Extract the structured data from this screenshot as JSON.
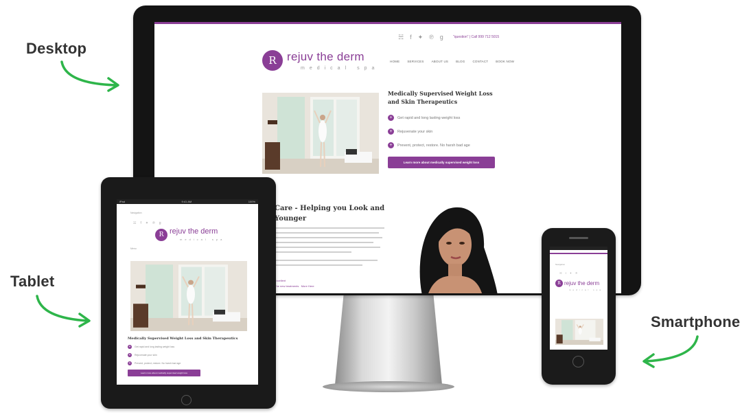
{
  "labels": {
    "desktop": "Desktop",
    "tablet": "Tablet",
    "smartphone": "Smartphone"
  },
  "site": {
    "brand_name": "rejuv the derm",
    "brand_sub": "medical spa",
    "logo_monogram": "R",
    "accent_color": "#8a3e96",
    "social_icons": [
      "rss-icon",
      "facebook-icon",
      "twitter-icon",
      "pinterest-icon",
      "google-plus-icon"
    ],
    "social_glyphs": [
      "☵",
      "f",
      "✦",
      "℗",
      "g"
    ],
    "phone": "\"question\" | Call 999 712 5015",
    "nav": [
      "HOME",
      "SERVICES",
      "ABOUT US",
      "BLOG",
      "CONTACT",
      "BOOK NOW"
    ],
    "feature_title_line1": "Medically Supervised Weight Loss",
    "feature_title_line2": "and Skin Therapeutics",
    "feature_title_full": "Medically Supervised Weight Loss and Skin Therapeutics",
    "bullets": [
      "Get rapid and long lasting weight loss",
      "Rejuvenate your skin",
      "Prevent, protect, restore. No harsh bad age"
    ],
    "cta": "Learn more about medically supervised weight loss",
    "section_title_line1": "Care - Helping you Look and",
    "section_title_line2": "Younger",
    "section_links": [
      "Excellent",
      "The new treatments",
      "More Here"
    ]
  },
  "tablet": {
    "status_left": "iPad",
    "status_center": "9:41 AM",
    "status_right": "100%",
    "menu_text": "Navigation",
    "menu_label": "Menu"
  },
  "phone": {
    "menu_text": "Navigation"
  }
}
